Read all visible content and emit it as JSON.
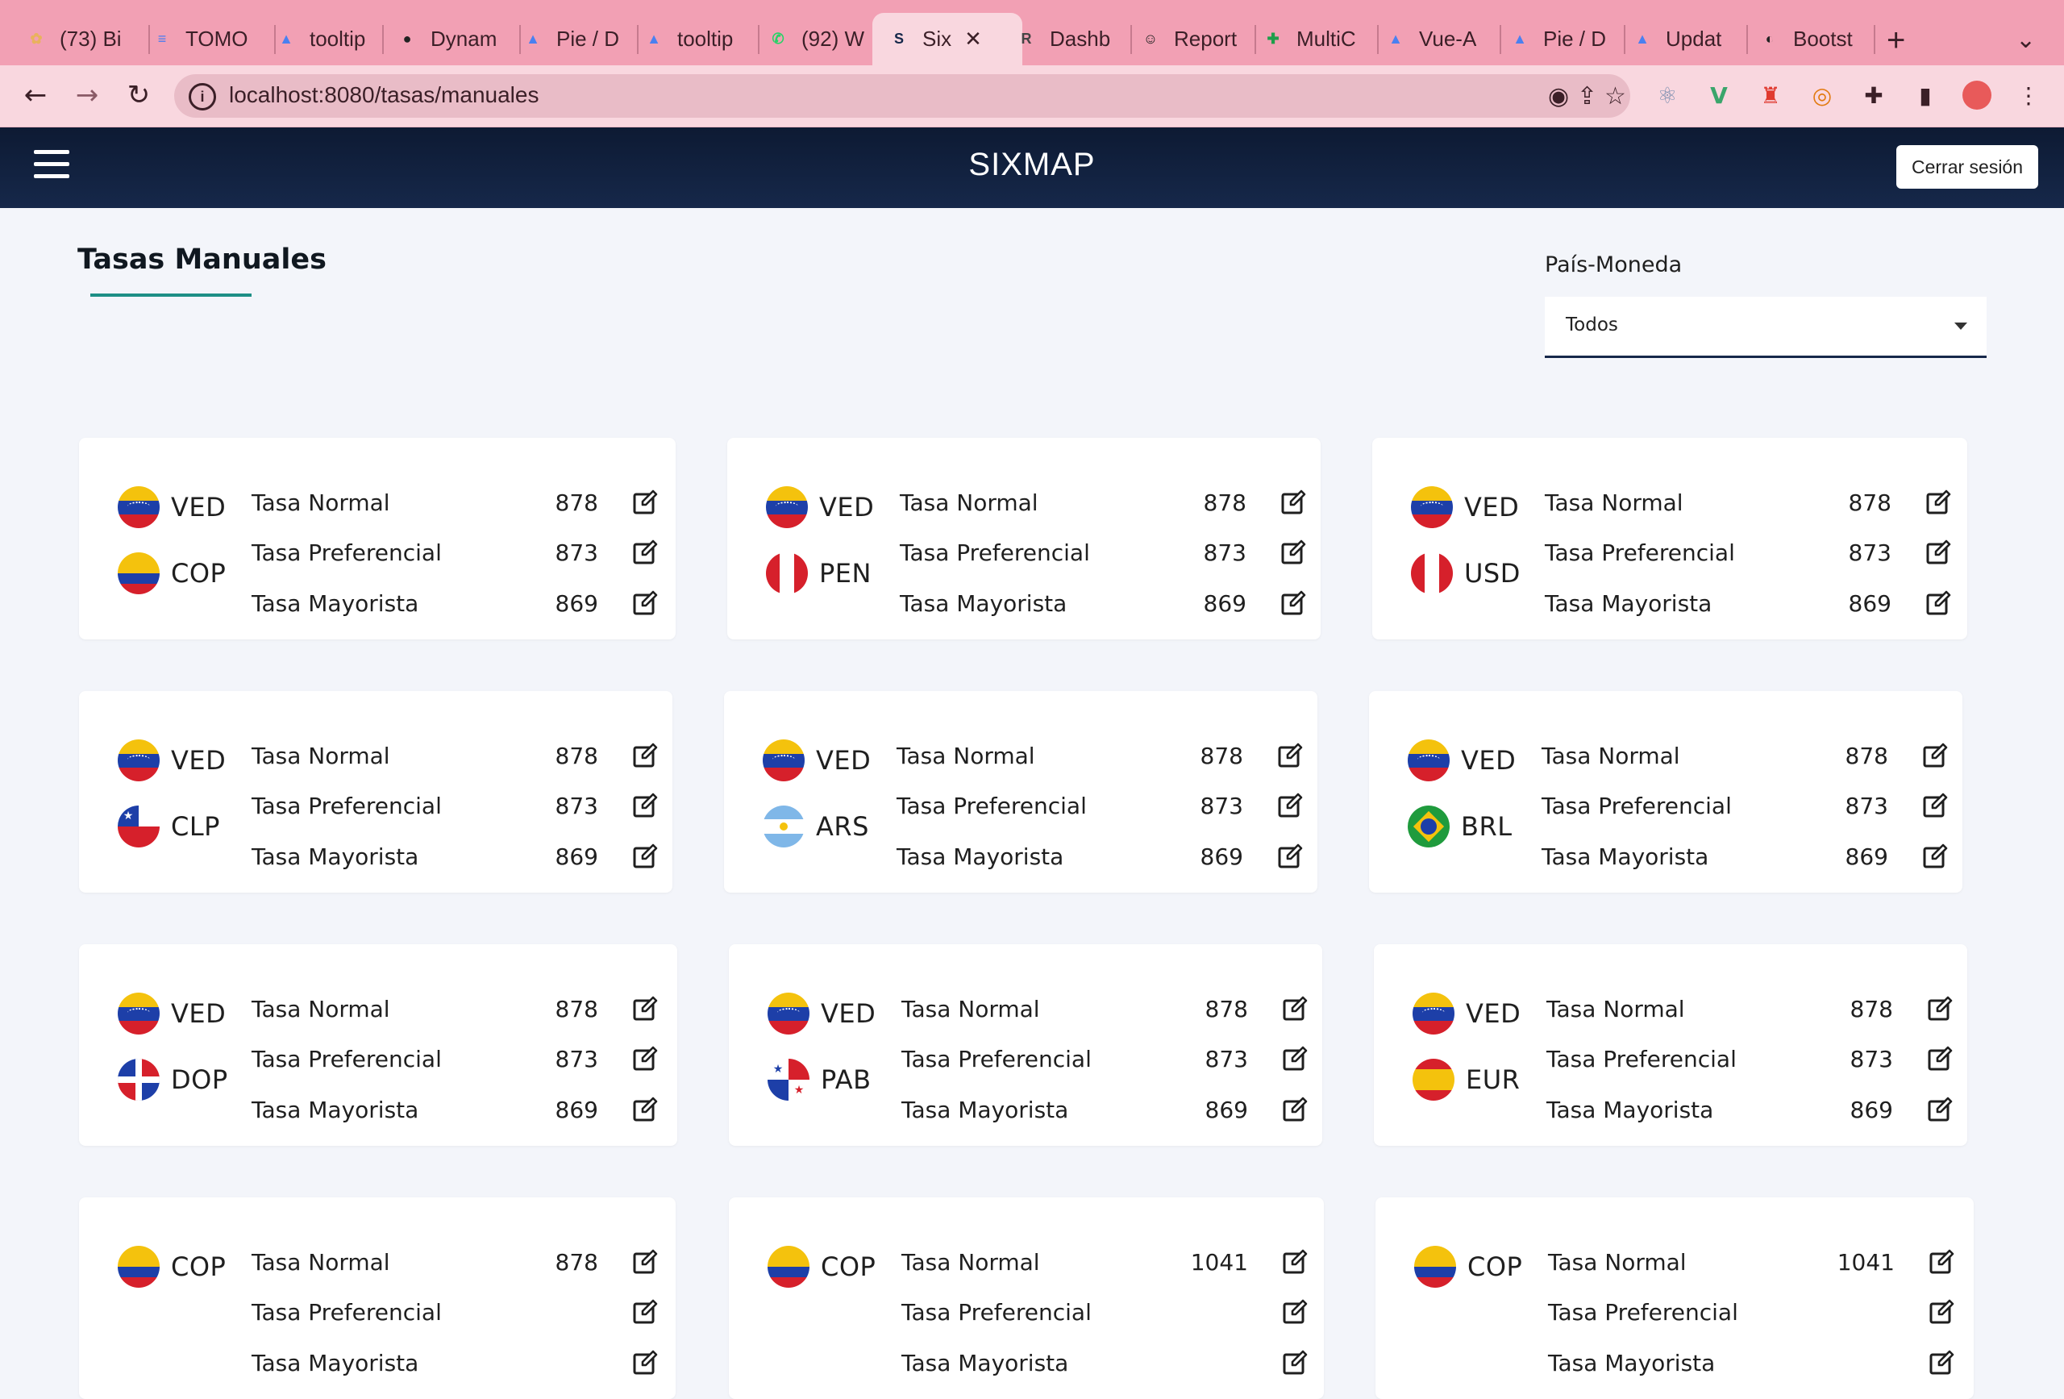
{
  "browser": {
    "tabs": [
      {
        "label": "(73) Bi",
        "icon": "multicolor-logo-icon",
        "color": "#e9b25c"
      },
      {
        "label": "TOMO",
        "icon": "docs-icon",
        "color": "#4a7cf0"
      },
      {
        "label": "tooltip",
        "icon": "triangle-logo-icon",
        "color": "#4a80f0"
      },
      {
        "label": "Dynam",
        "icon": "github-icon",
        "color": "#222222"
      },
      {
        "label": "Pie / D",
        "icon": "triangle-logo-icon",
        "color": "#4a80f0"
      },
      {
        "label": "tooltip",
        "icon": "triangle-logo-icon",
        "color": "#4a80f0"
      },
      {
        "label": "(92) W",
        "icon": "whatsapp-icon",
        "color": "#25d366"
      },
      {
        "label": "Six",
        "icon": "sixmap-icon",
        "color": "#16284a"
      },
      {
        "label": "Dashb",
        "icon": "remesa-icon",
        "color": "#444444"
      },
      {
        "label": "Report",
        "icon": "smiley-icon",
        "color": "#222222"
      },
      {
        "label": "MultiC",
        "icon": "sheets-icon",
        "color": "#1e9e4a"
      },
      {
        "label": "Vue-A",
        "icon": "triangle-logo-icon",
        "color": "#4a80f0"
      },
      {
        "label": "Pie / D",
        "icon": "triangle-logo-icon",
        "color": "#4a80f0"
      },
      {
        "label": "Updat",
        "icon": "triangle-logo-icon",
        "color": "#4a80f0"
      },
      {
        "label": "Bootst",
        "icon": "globe-icon",
        "color": "#222222"
      }
    ],
    "url": "localhost:8080/tasas/manuales"
  },
  "header": {
    "brand": "SIXMAP",
    "logout_label": "Cerrar sesión"
  },
  "page": {
    "title": "Tasas Manuales",
    "filter_label": "País-Moneda",
    "filter_value": "Todos"
  },
  "rate_labels": {
    "normal": "Tasa Normal",
    "preferencial": "Tasa Preferencial",
    "mayorista": "Tasa Mayorista"
  },
  "cards": [
    {
      "from": "VED",
      "to": "COP",
      "from_flag": "ve",
      "to_flag": "co",
      "normal": "878",
      "preferencial": "873",
      "mayorista": "869"
    },
    {
      "from": "VED",
      "to": "PEN",
      "from_flag": "ve",
      "to_flag": "pe",
      "normal": "878",
      "preferencial": "873",
      "mayorista": "869"
    },
    {
      "from": "VED",
      "to": "USD",
      "from_flag": "ve",
      "to_flag": "pe",
      "normal": "878",
      "preferencial": "873",
      "mayorista": "869"
    },
    {
      "from": "VED",
      "to": "CLP",
      "from_flag": "ve",
      "to_flag": "cl",
      "normal": "878",
      "preferencial": "873",
      "mayorista": "869"
    },
    {
      "from": "VED",
      "to": "ARS",
      "from_flag": "ve",
      "to_flag": "ar",
      "normal": "878",
      "preferencial": "873",
      "mayorista": "869"
    },
    {
      "from": "VED",
      "to": "BRL",
      "from_flag": "ve",
      "to_flag": "br",
      "normal": "878",
      "preferencial": "873",
      "mayorista": "869"
    },
    {
      "from": "VED",
      "to": "DOP",
      "from_flag": "ve",
      "to_flag": "do",
      "normal": "878",
      "preferencial": "873",
      "mayorista": "869"
    },
    {
      "from": "VED",
      "to": "PAB",
      "from_flag": "ve",
      "to_flag": "pa",
      "normal": "878",
      "preferencial": "873",
      "mayorista": "869"
    },
    {
      "from": "VED",
      "to": "EUR",
      "from_flag": "ve",
      "to_flag": "es",
      "normal": "878",
      "preferencial": "873",
      "mayorista": "869"
    },
    {
      "from": "COP",
      "to": "",
      "from_flag": "co",
      "to_flag": "",
      "normal": "878",
      "preferencial": "",
      "mayorista": ""
    },
    {
      "from": "COP",
      "to": "",
      "from_flag": "co",
      "to_flag": "",
      "normal": "1041",
      "preferencial": "",
      "mayorista": ""
    },
    {
      "from": "COP",
      "to": "",
      "from_flag": "co",
      "to_flag": "",
      "normal": "1041",
      "preferencial": "",
      "mayorista": ""
    }
  ],
  "colors": {
    "header_bg": "#0d1a33",
    "page_bg": "#f3f5fa",
    "accent_underline": "#1d8f86",
    "browser_tabbar": "#f2a0b4"
  }
}
